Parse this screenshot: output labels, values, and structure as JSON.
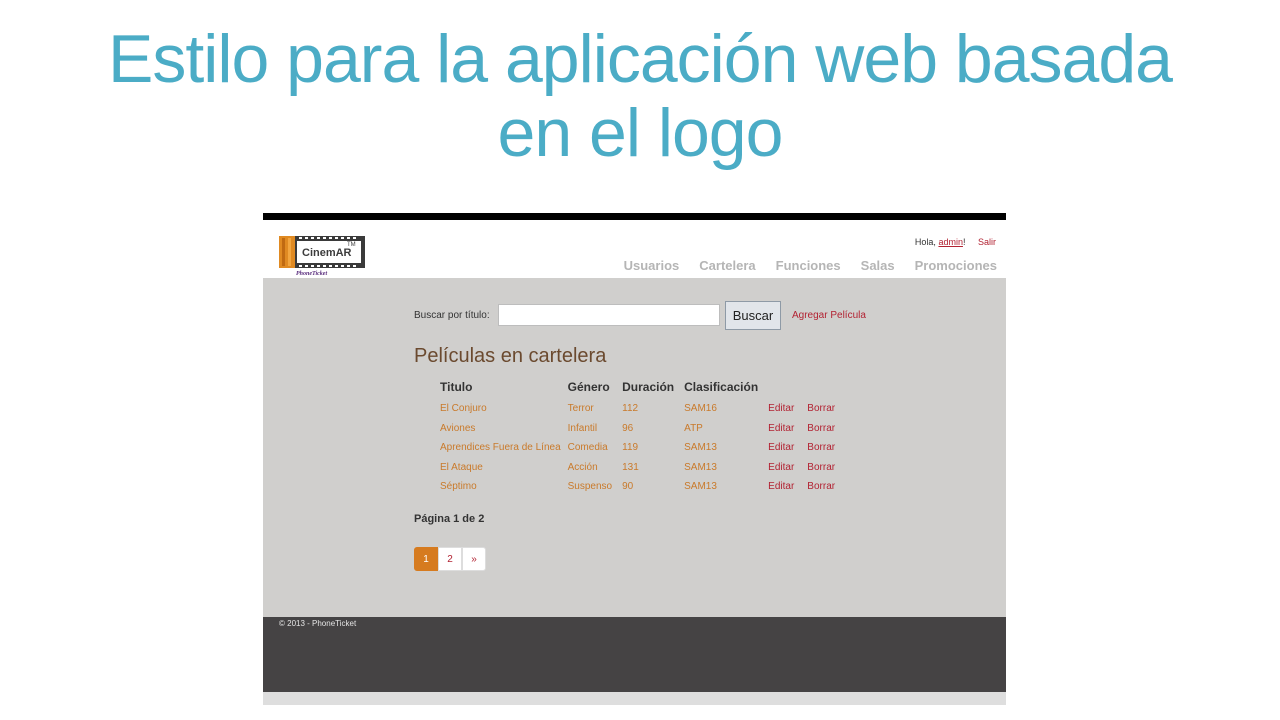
{
  "slide": {
    "title_line1": "Estilo para la aplicación web basada",
    "title_line2": "en el logo"
  },
  "app": {
    "logo": {
      "name": "CinemAR",
      "tm": "TM",
      "tagline": "PhoneTicket"
    },
    "greeting": {
      "prefix": "Hola, ",
      "user": "admin",
      "suffix": "!",
      "logout": "Salir"
    },
    "nav": [
      "Usuarios",
      "Cartelera",
      "Funciones",
      "Salas",
      "Promociones"
    ],
    "search": {
      "label": "Buscar por título:",
      "value": "",
      "button": "Buscar",
      "add_link": "Agregar Película"
    },
    "section_title": "Películas en cartelera",
    "table": {
      "headers": [
        "Titulo",
        "Género",
        "Duración",
        "Clasificación"
      ],
      "rows": [
        {
          "title": "El Conjuro",
          "genre": "Terror",
          "duration": "112",
          "rating": "SAM16",
          "edit": "Editar",
          "delete": "Borrar"
        },
        {
          "title": "Aviones",
          "genre": "Infantil",
          "duration": "96",
          "rating": "ATP",
          "edit": "Editar",
          "delete": "Borrar"
        },
        {
          "title": "Aprendices Fuera de Línea",
          "genre": "Comedia",
          "duration": "119",
          "rating": "SAM13",
          "edit": "Editar",
          "delete": "Borrar"
        },
        {
          "title": "El Ataque",
          "genre": "Acción",
          "duration": "131",
          "rating": "SAM13",
          "edit": "Editar",
          "delete": "Borrar"
        },
        {
          "title": "Séptimo",
          "genre": "Suspenso",
          "duration": "90",
          "rating": "SAM13",
          "edit": "Editar",
          "delete": "Borrar"
        }
      ]
    },
    "pagination": {
      "info": "Página 1 de 2",
      "pages": [
        "1",
        "2",
        "»"
      ],
      "active": "1"
    },
    "footer": "© 2013 - PhoneTicket",
    "colors": {
      "title": "#4bacc6",
      "accent": "#d67b1f",
      "link": "#b22232",
      "background": "#d0cfcd",
      "footer": "#454344"
    }
  }
}
